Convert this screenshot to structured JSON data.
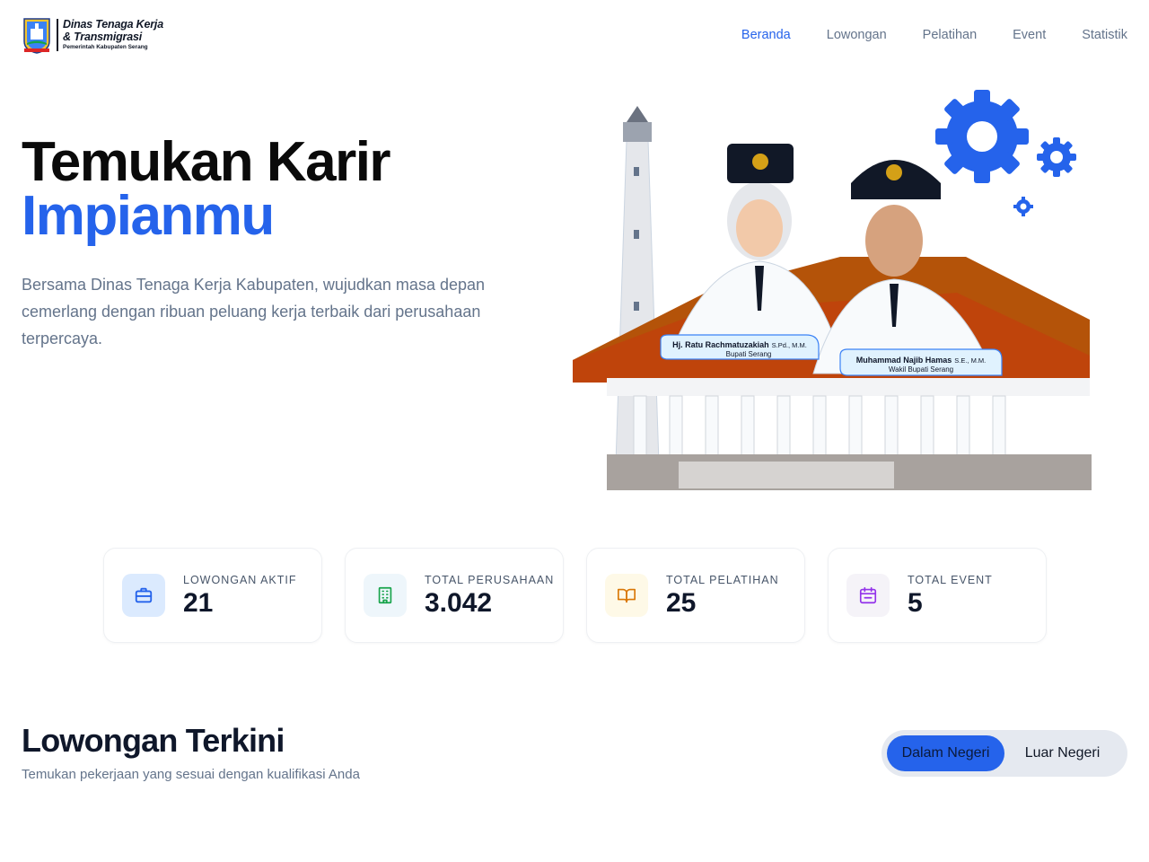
{
  "header": {
    "logo": {
      "title_line1": "Dinas Tenaga Kerja",
      "title_line2": "& Transmigrasi",
      "subtitle": "Pemerintah Kabupaten Serang"
    },
    "nav": [
      {
        "label": "Beranda",
        "active": true
      },
      {
        "label": "Lowongan",
        "active": false
      },
      {
        "label": "Pelatihan",
        "active": false
      },
      {
        "label": "Event",
        "active": false
      },
      {
        "label": "Statistik",
        "active": false
      }
    ]
  },
  "hero": {
    "title_line1": "Temukan Karir",
    "title_line2": "Impianmu",
    "description": "Bersama Dinas Tenaga Kerja Kabupaten, wujudkan masa depan cemerlang dengan ribuan peluang kerja terbaik dari perusahaan terpercaya.",
    "officials": [
      {
        "name": "Hj. Ratu Rachmatuzakiah",
        "degree": "S.Pd., M.M.",
        "role": "Bupati Serang"
      },
      {
        "name": "Muhammad Najib Hamas",
        "degree": "S.E., M.M.",
        "role": "Wakil Bupati Serang"
      }
    ]
  },
  "stats": [
    {
      "label": "LOWONGAN AKTIF",
      "value": "21",
      "icon": "briefcase-icon",
      "color": "#2563eb",
      "bg": "#dbeafe"
    },
    {
      "label": "TOTAL PERUSAHAAN",
      "value": "3.042",
      "icon": "building-icon",
      "color": "#16a34a",
      "bg": "#eef6fb"
    },
    {
      "label": "TOTAL PELATIHAN",
      "value": "25",
      "icon": "book-icon",
      "color": "#d97706",
      "bg": "#fef9e7"
    },
    {
      "label": "TOTAL EVENT",
      "value": "5",
      "icon": "calendar-icon",
      "color": "#9333ea",
      "bg": "#f5f3f8"
    }
  ],
  "section": {
    "title": "Lowongan Terkini",
    "subtitle": "Temukan pekerjaan yang sesuai dengan kualifikasi Anda",
    "toggle": {
      "active": "Dalam Negeri",
      "inactive": "Luar Negeri"
    }
  },
  "colors": {
    "accent": "#2563eb",
    "muted": "#64748b"
  }
}
